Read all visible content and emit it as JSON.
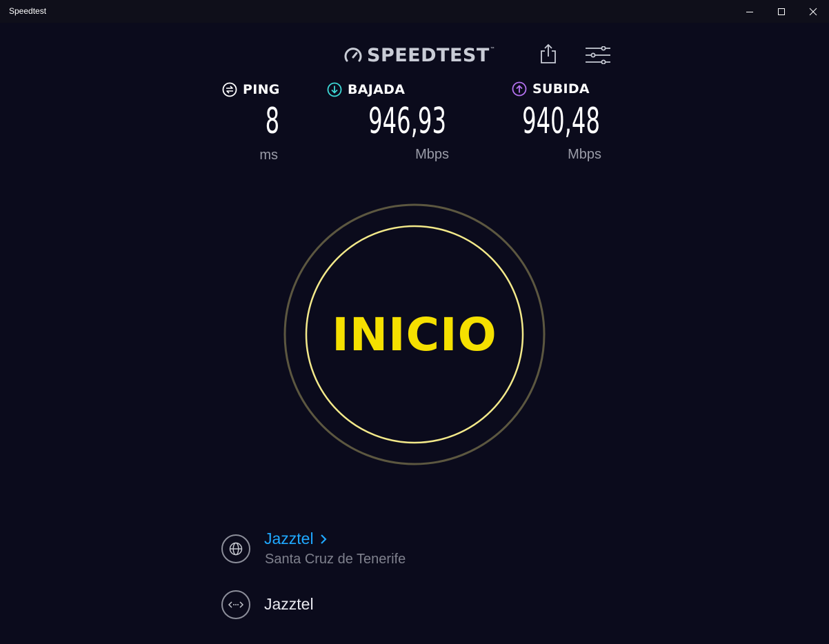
{
  "window": {
    "title": "Speedtest",
    "controls": {
      "minimize": "minimize-icon",
      "maximize": "maximize-icon",
      "close": "close-icon"
    }
  },
  "header": {
    "logo_text": "SPEEDTEST",
    "logo_mark": "™",
    "share_icon": "share-icon",
    "settings_icon": "settings-sliders-icon"
  },
  "metrics": {
    "ping": {
      "label": "PING",
      "value": "8",
      "unit": "ms",
      "icon": "ping-icon",
      "color": "#ffffff"
    },
    "download": {
      "label": "BAJADA",
      "value": "946,93",
      "unit": "Mbps",
      "icon": "download-arrow-icon",
      "color": "#3dd9d6"
    },
    "upload": {
      "label": "SUBIDA",
      "value": "940,48",
      "unit": "Mbps",
      "icon": "upload-arrow-icon",
      "color": "#b472f0"
    }
  },
  "go_button": {
    "label": "INICIO",
    "color": "#f5e000"
  },
  "connection": {
    "isp": {
      "name": "Jazztel",
      "location": "Santa Cruz de Tenerife",
      "icon": "globe-icon",
      "link_color": "#1fa8ff"
    },
    "server": {
      "name": "Jazztel",
      "icon": "server-icon"
    }
  }
}
